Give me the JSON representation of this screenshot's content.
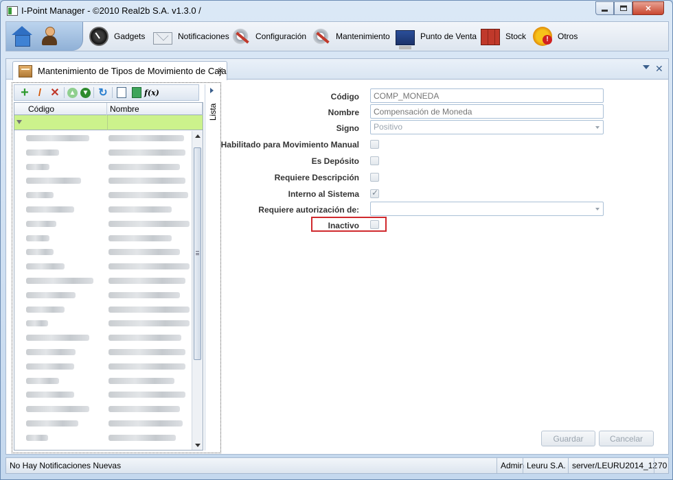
{
  "window": {
    "title": "I-Point Manager - ©2010 Real2b S.A. v1.3.0 /",
    "controls": {
      "minimize": "",
      "maximize": "",
      "close": "✕"
    }
  },
  "toolbar": {
    "items": [
      {
        "label": "Gadgets",
        "icon": "gauge-icon"
      },
      {
        "label": "Notificaciones",
        "icon": "envelope-icon"
      },
      {
        "label": "Configuración",
        "icon": "tools-icon"
      },
      {
        "label": "Mantenimiento",
        "icon": "tools-icon"
      },
      {
        "label": "Punto de Venta",
        "icon": "pos-terminal-icon"
      },
      {
        "label": "Stock",
        "icon": "boxes-icon"
      },
      {
        "label": "Otros",
        "icon": "gear-alert-icon"
      }
    ]
  },
  "tab": {
    "title": "Mantenimiento de Tipos de Movimiento de Caja",
    "close": "✕"
  },
  "list": {
    "side_label": "Lista",
    "columns": {
      "codigo": "Código",
      "nombre": "Nombre"
    },
    "row_count": 22
  },
  "form": {
    "codigo": {
      "label": "Código",
      "placeholder": "COMP_MONEDA"
    },
    "nombre": {
      "label": "Nombre",
      "placeholder": "Compensación de Moneda"
    },
    "signo": {
      "label": "Signo",
      "placeholder": "Positivo"
    },
    "habilitado_manual": {
      "label": "Habilitado para Movimiento Manual",
      "checked": false
    },
    "es_deposito": {
      "label": "Es Depósito",
      "checked": false
    },
    "requiere_descripcion": {
      "label": "Requiere Descripción",
      "checked": false
    },
    "interno_sistema": {
      "label": "Interno al Sistema",
      "checked": true
    },
    "requiere_autorizacion": {
      "label": "Requiere autorización de:",
      "placeholder": ""
    },
    "inactivo": {
      "label": "Inactivo",
      "checked": false
    },
    "buttons": {
      "guardar": "Guardar",
      "cancelar": "Cancelar"
    }
  },
  "statusbar": {
    "message": "No Hay Notificaciones Nuevas",
    "user": "Admin",
    "company": "Leuru S.A.",
    "server": "server/LEURU2014_12",
    "number": "70"
  },
  "colors": {
    "filter_row": "#ccf28c",
    "highlight": "#d0282c"
  }
}
